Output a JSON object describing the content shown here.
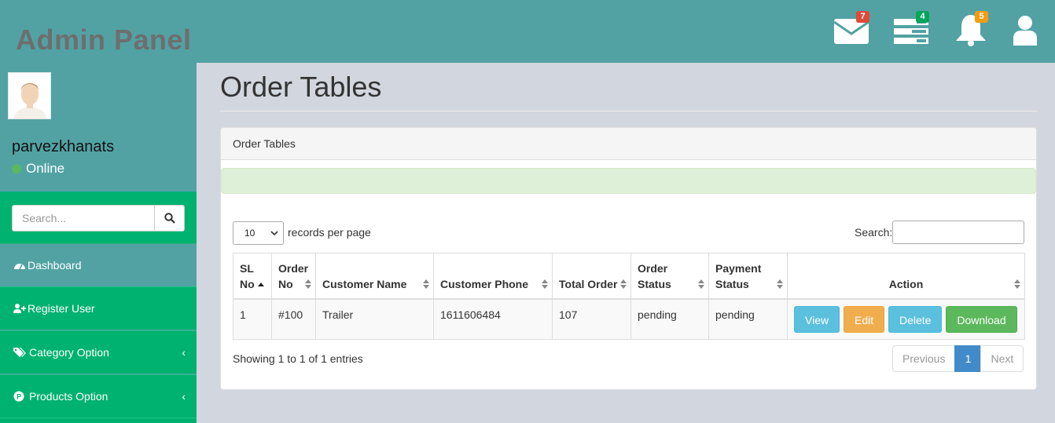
{
  "header": {
    "brand": "Admin Panel",
    "icons": [
      {
        "name": "envelope-icon",
        "badge": "7",
        "badge_color": "#dd4b39"
      },
      {
        "name": "tasks-icon",
        "badge": "4",
        "badge_color": "#00a65a"
      },
      {
        "name": "bell-icon",
        "badge": "5",
        "badge_color": "#f39c12"
      },
      {
        "name": "user-icon",
        "badge": ""
      }
    ]
  },
  "sidebar": {
    "username": "parvezkhanats",
    "status": "Online",
    "search_placeholder": "Search...",
    "items": [
      {
        "label": "Dashboard",
        "icon": "dashboard-icon"
      },
      {
        "label": "Register User",
        "icon": "user-plus-icon"
      },
      {
        "label": "Category Option",
        "icon": "tags-icon",
        "chevron": "‹"
      },
      {
        "label": "Products Option",
        "icon": "product-icon",
        "chevron": "‹"
      }
    ]
  },
  "main": {
    "page_title": "Order Tables",
    "panel_title": "Order Tables",
    "length_value": "10",
    "length_label": "records per page",
    "search_label": "Search:",
    "table": {
      "headers": [
        {
          "line1": "SL",
          "line2": "No"
        },
        {
          "line1": "Order",
          "line2": "No"
        },
        {
          "line1": "",
          "line2": "Customer Name"
        },
        {
          "line1": "",
          "line2": "Customer Phone"
        },
        {
          "line1": "",
          "line2": "Total Order"
        },
        {
          "line1": "Order",
          "line2": "Status"
        },
        {
          "line1": "Payment",
          "line2": "Status"
        },
        {
          "line1": "",
          "line2": "Action"
        }
      ],
      "rows": [
        {
          "sl": "1",
          "order_no": "#100",
          "customer_name": "Trailer",
          "customer_phone": "1611606484",
          "total_order": "107",
          "order_status": "pending",
          "payment_status": "pending"
        }
      ],
      "action_buttons": {
        "view": "View",
        "edit": "Edit",
        "delete": "Delete",
        "download": "Download"
      }
    },
    "info": "Showing 1 to 1 of 1 entries",
    "pagination": {
      "previous": "Previous",
      "current": "1",
      "next": "Next"
    }
  },
  "colors": {
    "header_bg": "#52a2a4",
    "sidebar_green": "#00b26f",
    "brand_text": "#6e6e6e",
    "content_bg": "#d2d6de",
    "alert_success_bg": "#dff0d8",
    "btn_info": "#5bc0de",
    "btn_warning": "#f0ad4e",
    "btn_success": "#5cb85c",
    "pagination_active": "#428bca"
  }
}
